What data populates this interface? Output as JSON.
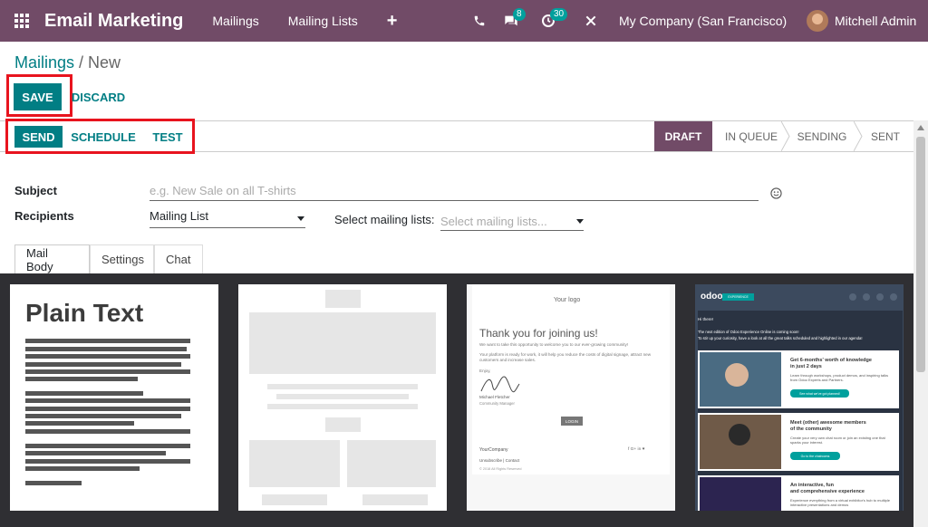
{
  "navbar": {
    "app_name": "Email Marketing",
    "menu": [
      "Mailings",
      "Mailing Lists"
    ],
    "add_icon": "+",
    "phone_icon": "phone-icon",
    "messages_count": "8",
    "activities_count": "30",
    "company": "My Company (San Francisco)",
    "user": "Mitchell Admin"
  },
  "breadcrumb": {
    "parent": "Mailings",
    "separator": " / ",
    "current": "New"
  },
  "actions": {
    "save": "SAVE",
    "discard": "DISCARD"
  },
  "statusbar": {
    "buttons": {
      "send": "SEND",
      "schedule": "SCHEDULE",
      "test": "TEST"
    },
    "stages": [
      "DRAFT",
      "IN QUEUE",
      "SENDING",
      "SENT"
    ],
    "active_stage": "DRAFT"
  },
  "form": {
    "subject_label": "Subject",
    "subject_placeholder": "e.g. New Sale on all T-shirts",
    "recipients_label": "Recipients",
    "recipients_value": "Mailing List",
    "lists_label": "Select mailing lists:",
    "lists_placeholder": "Select mailing lists..."
  },
  "tabs": [
    "Mail Body",
    "Settings",
    "Chat"
  ],
  "themes": {
    "plain": {
      "title": "Plain Text"
    },
    "welcome": {
      "logo": "Your logo",
      "heading": "Thank you for joining us!",
      "p1": "We want to take this opportunity to welcome you to our ever-growing community!",
      "p2": "Your platform is ready for work, it will help you reduce the costs of digital signage, attract new customers and increase sales.",
      "regards": "Enjoy,",
      "signer": "Michael Fletcher",
      "role": "Community Manager",
      "button": "LOGIN",
      "company": "YourCompany",
      "links": "Unsubscribe | Contact",
      "copyright": "© 2018 All Rights Reserved",
      "social": "f  G+  in  ♥"
    },
    "event": {
      "logo": "odoo",
      "tag": "EXPERIENCE",
      "hi": "Hi there!",
      "intro1": "The next edition of Odoo Experience Online is coming soon!",
      "intro2": "To stir up your curiosity, have a look at all the great talks scheduled and highlighted in our agenda!",
      "items": [
        {
          "title1": "Get 6-months' worth of knowledge",
          "title2": "in just 2 days",
          "text": "Learn through workshops, product demos, and inspiring talks from Odoo Experts and Partners.",
          "button": "See what we've got planned!"
        },
        {
          "title1": "Meet (other) awesome members",
          "title2": "of the community",
          "text": "Create your very own chat room or join an existing one that sparks your interest.",
          "button": "Go to the chatrooms"
        },
        {
          "title1": "An interactive, fun",
          "title2": "and comprehensive experience",
          "text": "Experience everything from a virtual exhibitor's hub to multiple interactive presentations and demos",
          "button": ""
        }
      ]
    }
  }
}
